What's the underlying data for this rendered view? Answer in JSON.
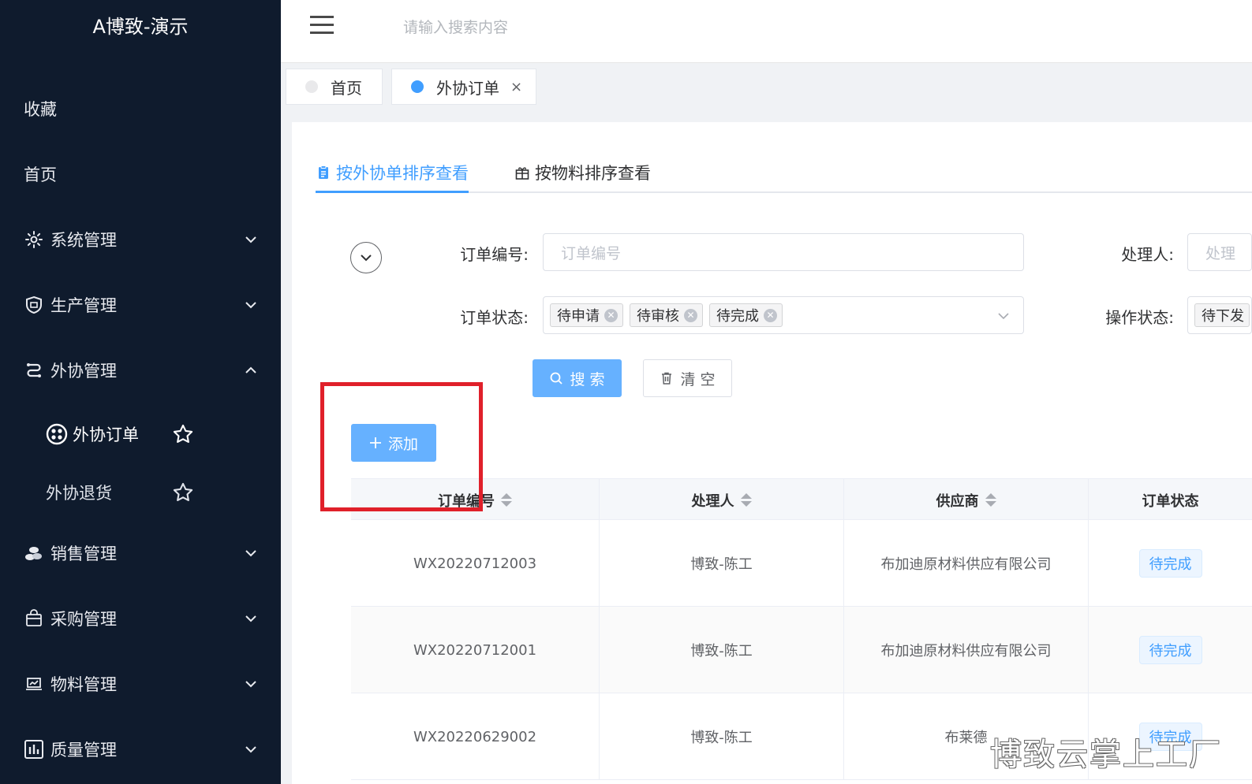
{
  "sidebar": {
    "brand": "A博致-演示",
    "favorites_label": "收藏",
    "home_label": "首页",
    "groups": [
      {
        "label": "系统管理",
        "icon": "gear-icon",
        "expanded": false
      },
      {
        "label": "生产管理",
        "icon": "factory-shield-icon",
        "expanded": false
      },
      {
        "label": "外协管理",
        "icon": "route-icon",
        "expanded": true
      },
      {
        "label": "销售管理",
        "icon": "coins-icon",
        "expanded": false
      },
      {
        "label": "采购管理",
        "icon": "shopping-bag-icon",
        "expanded": false
      },
      {
        "label": "物料管理",
        "icon": "laptop-chart-icon",
        "expanded": false
      },
      {
        "label": "质量管理",
        "icon": "bar-chart-icon",
        "expanded": false
      }
    ],
    "sub_items": [
      {
        "label": "外协订单",
        "active": true,
        "icon": "network-icon"
      },
      {
        "label": "外协退货",
        "active": false
      }
    ]
  },
  "header": {
    "search_placeholder": "请输入搜索内容"
  },
  "tabs": [
    {
      "label": "首页",
      "active": false
    },
    {
      "label": "外协订单",
      "active": true,
      "close": "×"
    }
  ],
  "subtabs": [
    {
      "label": "按外协单排序查看",
      "active": true
    },
    {
      "label": "按物料排序查看",
      "active": false
    }
  ],
  "filters": {
    "order_no_label": "订单编号:",
    "order_no_placeholder": "订单编号",
    "handler_label": "处理人:",
    "handler_placeholder": "处理",
    "status_label": "订单状态:",
    "status_tags": [
      "待申请",
      "待审核",
      "待完成"
    ],
    "op_status_label": "操作状态:",
    "op_status_tag": "待下发"
  },
  "actions": {
    "search_label": "搜 索",
    "clear_label": "清 空",
    "add_label": "添加"
  },
  "table": {
    "columns": [
      "订单编号",
      "处理人",
      "供应商",
      "订单状态"
    ],
    "rows": [
      {
        "order_no": "WX20220712003",
        "handler": "博致-陈工",
        "supplier": "布加迪原材料供应有限公司",
        "status": "待完成"
      },
      {
        "order_no": "WX20220712001",
        "handler": "博致-陈工",
        "supplier": "布加迪原材料供应有限公司",
        "status": "待完成"
      },
      {
        "order_no": "WX20220629002",
        "handler": "博致-陈工",
        "supplier": "布莱德",
        "status": "待完成"
      }
    ]
  },
  "watermark": "博致云掌上工厂",
  "colors": {
    "sidebar_bg": "#0f1b2d",
    "accent": "#409eff",
    "primary_button": "#66b1ff",
    "highlight_box": "#e0202a"
  }
}
